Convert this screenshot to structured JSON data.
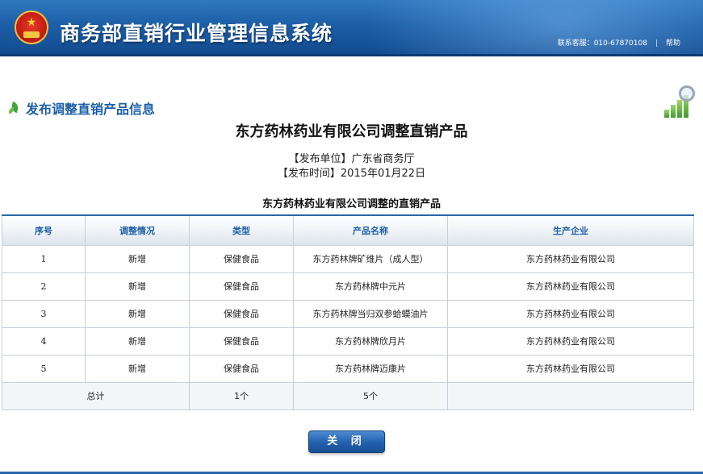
{
  "header": {
    "app_title": "商务部直销行业管理信息系统",
    "hotline": "联系客服：010-67870108",
    "separator": "|",
    "help_label": "帮助"
  },
  "section": {
    "title": "发布调整直销产品信息"
  },
  "document": {
    "title": "东方药林药业有限公司调整直销产品",
    "publisher_line": "【发布单位】广东省商务厅",
    "publish_time_line": "【发布时间】2015年01月22日",
    "table_caption": "东方药林药业有限公司调整的直销产品"
  },
  "table": {
    "columns": [
      "序号",
      "调整情况",
      "类型",
      "产品名称",
      "生产企业"
    ],
    "rows": [
      [
        "1",
        "新增",
        "保健食品",
        "东方药林牌矿维片（成人型）",
        "东方药林药业有限公司"
      ],
      [
        "2",
        "新增",
        "保健食品",
        "东方药林牌中元片",
        "东方药林药业有限公司"
      ],
      [
        "3",
        "新增",
        "保健食品",
        "东方药林牌当归双参蛤蟆油片",
        "东方药林药业有限公司"
      ],
      [
        "4",
        "新增",
        "保健食品",
        "东方药林牌欣月片",
        "东方药林药业有限公司"
      ],
      [
        "5",
        "新增",
        "保健食品",
        "东方药林牌迈康片",
        "东方药林药业有限公司"
      ]
    ],
    "total": {
      "label": "总计",
      "type_count": "1个",
      "product_count": "5个"
    }
  },
  "actions": {
    "close_label": "关 闭"
  },
  "colors": {
    "header_blue": "#1c5ea6",
    "title_blue": "#1d5fa8",
    "button_blue": "#225fac"
  },
  "icons": {
    "emblem": "national-emblem",
    "section": "leaf-icon",
    "corner": "chart-magnifier-icon"
  }
}
